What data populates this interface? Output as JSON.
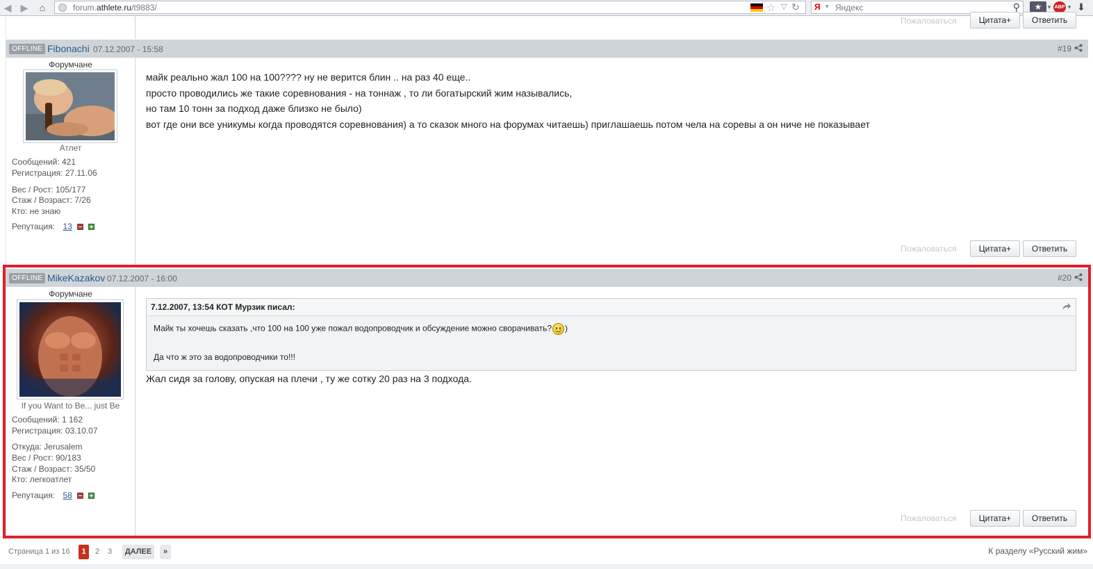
{
  "browser": {
    "url_prefix": "forum.",
    "url_domain": "athlete.ru",
    "url_path": "/t9883/",
    "search_placeholder": "Яндекс",
    "yandex_logo": "Я",
    "abp_label": "ABP"
  },
  "top_actions": {
    "complain": "Пожаловаться",
    "quote": "Цитата+",
    "reply": "Ответить"
  },
  "posts": [
    {
      "badge": "OFFLINE",
      "author": "Fibonachi",
      "date": "07.12.2007 - 15:58",
      "number": "#19",
      "rank": "Форумчане",
      "status": "Атлет",
      "messages": "Сообщений: 421",
      "registration": "Регистрация: 27.11.06",
      "weight": "Вес / Рост: 105/177",
      "experience": "Стаж / Возраст:  7/26",
      "who": "Кто: не знаю",
      "reputation_label": "Репутация:",
      "reputation_value": "13",
      "lines": [
        "майк реально жал 100 на 100???? ну не верится блин .. на раз 40 еще..",
        "просто проводились же такие соревнования - на тоннаж , то ли богатырский жим назывались,",
        "но там 10 тонн за подход даже близко не было)",
        "вот где они все уникумы когда проводятся соревнования) а то сказок много на форумах читаешь) приглашаешь потом чела на соревы а он ниче не показывает"
      ],
      "complain": "Пожаловаться",
      "quote": "Цитата+",
      "reply": "Ответить"
    },
    {
      "badge": "OFFLINE",
      "author": "MikeKazakov",
      "date": "07.12.2007 - 16:00",
      "number": "#20",
      "rank": "Форумчане",
      "status": "If you Want to Be... just Be",
      "messages": "Сообщений: 1 162",
      "registration": "Регистрация: 03.10.07",
      "from": "Откуда: Jerusalem",
      "weight": "Вес / Рост: 90/183",
      "experience": "Стаж / Возраст:  35/50",
      "who": "Кто: легкоатлет",
      "reputation_label": "Репутация:",
      "reputation_value": "58",
      "quote_header": "7.12.2007, 13:54 КОТ Мурзик писал:",
      "quote_line1": "Майк ты хочешь сказать ,что 100 на 100 уже пожал водопроводчик и обсуждение можно сворачивать?",
      "quote_line1_end": ")",
      "quote_line2": "Да что ж это за водопроводчики то!!!",
      "text": "Жал сидя за голову, опуская на плечи , ту же сотку 20 раз на 3 подхода.",
      "complain": "Пожаловаться",
      "quote": "Цитата+",
      "reply": "Ответить"
    }
  ],
  "pagination": {
    "label": "Страница 1 из 16",
    "pages": [
      "1",
      "2",
      "3"
    ],
    "next": "ДАЛЕЕ",
    "last": "»"
  },
  "section_link": "К разделу «Русский жим»"
}
